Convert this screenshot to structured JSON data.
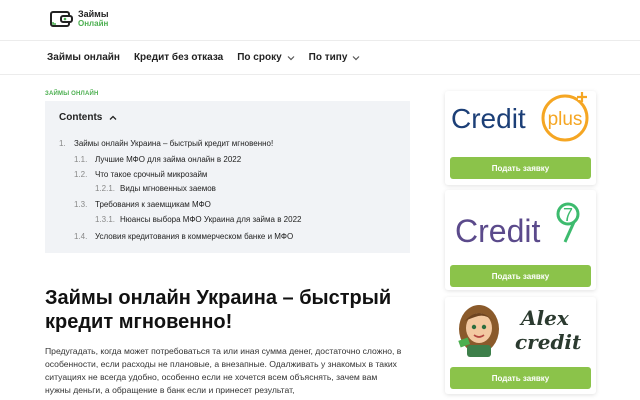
{
  "header": {
    "logo_line1": "Займы",
    "logo_line2": "Онлайн"
  },
  "nav": {
    "items": [
      {
        "label": "Займы онлайн"
      },
      {
        "label": "Кредит без отказа"
      },
      {
        "label": "По сроку"
      },
      {
        "label": "По типу"
      }
    ]
  },
  "breadcrumb": "ЗАЙМЫ ОНЛАЙН",
  "toc": {
    "title": "Contents",
    "items": [
      {
        "num": "1.",
        "label": "Займы онлайн Украина – быстрый кредит мгновенно!"
      },
      {
        "num": "1.1.",
        "label": "Лучшие МФО для займа онлайн в 2022"
      },
      {
        "num": "1.2.",
        "label": "Что такое срочный микрозайм"
      },
      {
        "num": "1.2.1.",
        "label": "Виды мгновенных заемов"
      },
      {
        "num": "1.3.",
        "label": "Требования к заемщикам МФО"
      },
      {
        "num": "1.3.1.",
        "label": "Нюансы выбора МФО Украина для займа в 2022"
      },
      {
        "num": "1.4.",
        "label": "Условия кредитования в коммерческом банке и МФО"
      }
    ]
  },
  "article": {
    "title": "Займы онлайн Украина – быстрый кредит мгновенно!",
    "paragraph": "Предугадать, когда может потребоваться та или иная сумма денег, достаточно сложно, в особенности, если расходы не плановые, а внезапные. Одалживать у знакомых в таких ситуациях не всегда удобно, особенно если не хочется всем объяснять, зачем вам нужны деньги, а обращение в банк если и принесет результат,"
  },
  "sidebar": {
    "cards": [
      {
        "brand_a": "Credit",
        "brand_b": "plus",
        "button": "Подать заявку"
      },
      {
        "brand_a": "Credit",
        "brand_b": "7",
        "button": "Подать заявку"
      },
      {
        "brand_a": "Alex",
        "brand_b": "credit",
        "button": "Подать заявку"
      }
    ]
  },
  "colors": {
    "accent_green": "#4caf50",
    "button_green": "#8bc34a",
    "creditplus_blue": "#1c3f77",
    "creditplus_orange": "#f5a623",
    "credit7_purple": "#5b4a8b",
    "credit7_green": "#3dbb6e",
    "alex_dark": "#2b3a2f"
  }
}
